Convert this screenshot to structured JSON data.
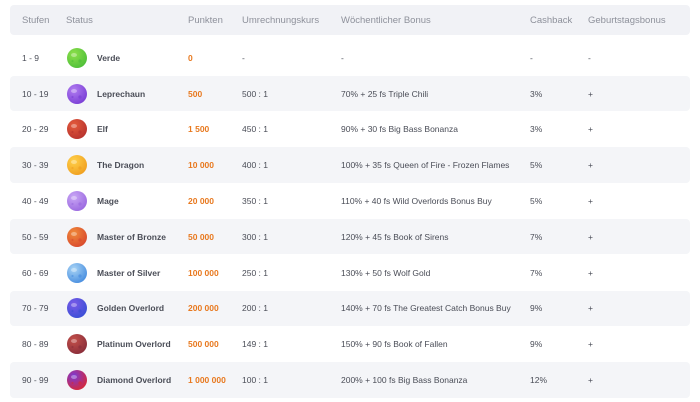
{
  "headers": {
    "stufen": "Stufen",
    "status": "Status",
    "punkten": "Punkten",
    "kurs": "Umrechnungskurs",
    "bonus": "Wöchentlicher Bonus",
    "cashback": "Cashback",
    "geburtstag": "Geburtstagsbonus"
  },
  "rows": [
    {
      "stufen": "1 - 9",
      "icon": "green-planet-icon",
      "color": "#4fbf3a",
      "color2": "#8de04a",
      "status": "Verde",
      "punkten": "0",
      "kurs": "-",
      "bonus": "-",
      "cashback": "-",
      "geburtstag": "-"
    },
    {
      "stufen": "10 - 19",
      "icon": "purple-planet-icon",
      "color": "#7b3fd6",
      "color2": "#b07cf0",
      "status": "Leprechaun",
      "punkten": "500",
      "kurs": "500 : 1",
      "bonus": "70% + 25 fs Triple Chili",
      "cashback": "3%",
      "geburtstag": "+"
    },
    {
      "stufen": "20 - 29",
      "icon": "red-planet-icon",
      "color": "#b8332e",
      "color2": "#e45b3c",
      "status": "Elf",
      "punkten": "1 500",
      "kurs": "450 : 1",
      "bonus": "90% + 30 fs Big Bass Bonanza",
      "cashback": "3%",
      "geburtstag": "+"
    },
    {
      "stufen": "30 - 39",
      "icon": "orange-planet-icon",
      "color": "#f0a020",
      "color2": "#ffd04a",
      "status": "The Dragon",
      "punkten": "10 000",
      "kurs": "400 : 1",
      "bonus": "100% + 35 fs Queen of Fire - Frozen Flames",
      "cashback": "5%",
      "geburtstag": "+"
    },
    {
      "stufen": "40 - 49",
      "icon": "violet-planet-icon",
      "color": "#9b6ae0",
      "color2": "#c9a6f5",
      "status": "Mage",
      "punkten": "20 000",
      "kurs": "350 : 1",
      "bonus": "110% + 40 fs Wild Overlords Bonus Buy",
      "cashback": "5%",
      "geburtstag": "+"
    },
    {
      "stufen": "50 - 59",
      "icon": "bronze-planet-icon",
      "color": "#d94a2e",
      "color2": "#f08a3a",
      "status": "Master of Bronze",
      "punkten": "50 000",
      "kurs": "300 : 1",
      "bonus": "120% + 45 fs Book of Sirens",
      "cashback": "7%",
      "geburtstag": "+"
    },
    {
      "stufen": "60 - 69",
      "icon": "silver-planet-icon",
      "color": "#4a8fe0",
      "color2": "#a8d4f5",
      "status": "Master of Silver",
      "punkten": "100 000",
      "kurs": "250 : 1",
      "bonus": "130% + 50 fs Wolf Gold",
      "cashback": "7%",
      "geburtstag": "+"
    },
    {
      "stufen": "70 - 79",
      "icon": "blue-planet-icon",
      "color": "#3a4fd6",
      "color2": "#7a5ae8",
      "status": "Golden Overlord",
      "punkten": "200 000",
      "kurs": "200 : 1",
      "bonus": "140% + 70 fs The Greatest Catch Bonus Buy",
      "cashback": "9%",
      "geburtstag": "+"
    },
    {
      "stufen": "80 - 89",
      "icon": "maroon-planet-icon",
      "color": "#8a2e3a",
      "color2": "#c4504a",
      "status": "Platinum Overlord",
      "punkten": "500 000",
      "kurs": "149 : 1",
      "bonus": "150% + 90 fs Book of Fallen",
      "cashback": "9%",
      "geburtstag": "+"
    },
    {
      "stufen": "90 - 99",
      "icon": "crimson-planet-icon",
      "color": "#d6283a",
      "color2": "#7a3ad6",
      "status": "Diamond Overlord",
      "punkten": "1 000 000",
      "kurs": "100 : 1",
      "bonus": "200% + 100 fs Big Bass Bonanza",
      "cashback": "12%",
      "geburtstag": "+"
    }
  ]
}
